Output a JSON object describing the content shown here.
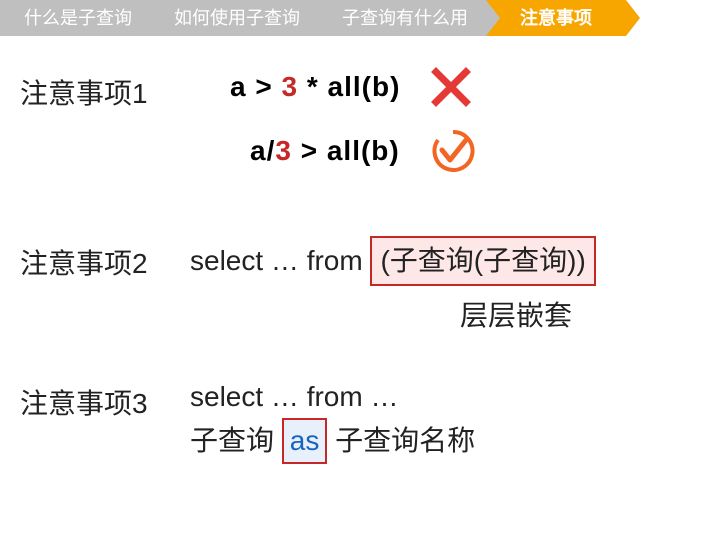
{
  "tabs": {
    "t1": "什么是子查询",
    "t2": "如何使用子查询",
    "t3": "子查询有什么用",
    "t4": "注意事项"
  },
  "section1": {
    "label": "注意事项1",
    "formula1_a": "a > ",
    "formula1_b": "3",
    "formula1_c": " * all(b)",
    "formula2_a": "a/",
    "formula2_b": "3",
    "formula2_c": " > all(b)"
  },
  "section2": {
    "label": "注意事项2",
    "prefix": "select … from ",
    "boxed": "(子查询(子查询))",
    "caption": "层层嵌套"
  },
  "section3": {
    "label": "注意事项3",
    "line1": "select … from …",
    "line2_a": "子查询 ",
    "line2_as": "as",
    "line2_b": " 子查询名称"
  },
  "colors": {
    "red": "#c62828",
    "orange": "#f7a600",
    "gray": "#bfbfbf",
    "blue": "#1565c0"
  }
}
